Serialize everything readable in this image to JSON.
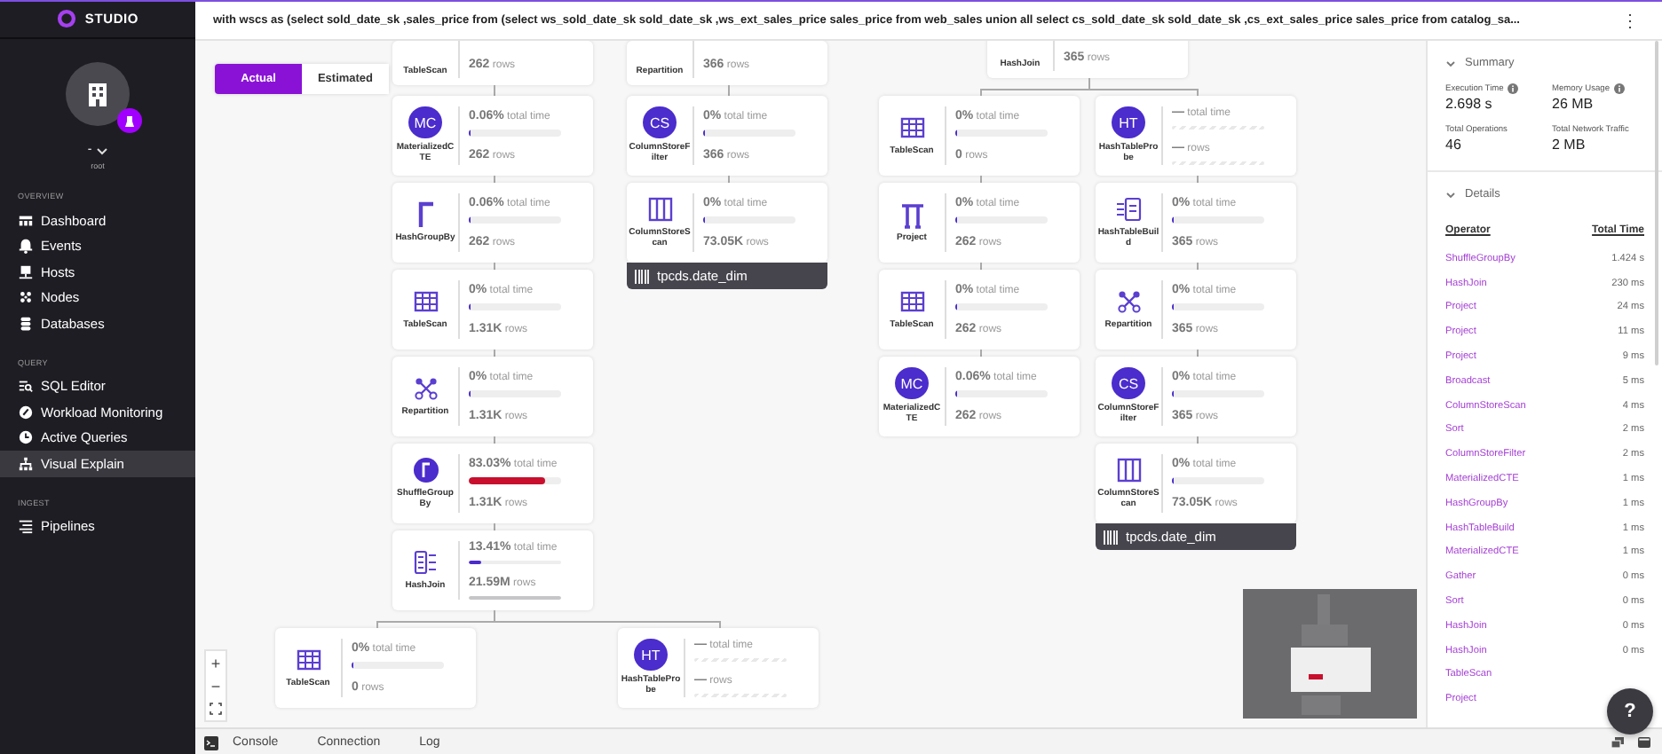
{
  "sidebar": {
    "brand": "STUDIO",
    "account": {
      "name": "-",
      "user": "root"
    },
    "sections": [
      {
        "heading": "OVERVIEW",
        "items": [
          {
            "label": "Dashboard",
            "kind": "dashboard",
            "selected": false
          },
          {
            "label": "Events",
            "kind": "events",
            "selected": false
          },
          {
            "label": "Hosts",
            "kind": "hosts",
            "selected": false
          },
          {
            "label": "Nodes",
            "kind": "nodes",
            "selected": false
          },
          {
            "label": "Databases",
            "kind": "databases",
            "selected": false
          }
        ]
      },
      {
        "heading": "QUERY",
        "items": [
          {
            "label": "SQL Editor",
            "kind": "sql_editor",
            "selected": false
          },
          {
            "label": "Workload Monitoring",
            "kind": "workload",
            "selected": false
          },
          {
            "label": "Active Queries",
            "kind": "active_queries",
            "selected": false
          },
          {
            "label": "Visual Explain",
            "kind": "visual_explain",
            "selected": true
          }
        ]
      },
      {
        "heading": "INGEST",
        "items": [
          {
            "label": "Pipelines",
            "kind": "pipelines",
            "selected": false
          }
        ]
      }
    ]
  },
  "topbar": {
    "query": "with wscs as (select sold_date_sk ,sales_price from (select ws_sold_date_sk sold_date_sk ,ws_ext_sales_price sales_price from web_sales union all select cs_sold_date_sk sold_date_sk ,cs_ext_sales_price sales_price from catalog_sa...",
    "menu": "⋮"
  },
  "view_toggle": [
    {
      "label": "Actual",
      "selected": true
    },
    {
      "label": "Estimated",
      "selected": false
    }
  ],
  "plan": [
    {
      "nodes": [
        {
          "label": "TableScan",
          "rows": "262",
          "rows_unit": "rows"
        },
        {
          "kind": "badge",
          "badge": "MC",
          "label": "MaterializedCTE",
          "time": "0.06%",
          "time_unit": "total time",
          "measured": true,
          "level": 0.0006,
          "rows": "262",
          "rows_unit": "rows"
        },
        {
          "kind": "bracket",
          "label": "HashGroupBy",
          "time": "0.06%",
          "time_unit": "total time",
          "measured": true,
          "level": 0.0006,
          "rows": "262",
          "rows_unit": "rows"
        },
        {
          "kind": "grid",
          "label": "TableScan",
          "time": "0%",
          "time_unit": "total time",
          "measured": true,
          "level": 0,
          "rows": "1.31K",
          "rows_unit": "rows"
        },
        {
          "kind": "network",
          "label": "Repartition",
          "time": "0%",
          "time_unit": "total time",
          "measured": true,
          "level": 0,
          "rows": "1.31K",
          "rows_unit": "rows"
        },
        {
          "kind": "gamma",
          "label": "ShuffleGroupBy",
          "time": "83.03%",
          "time_unit": "total time",
          "measured": true,
          "level": 0.8303,
          "rows": "1.31K",
          "rows_unit": "rows"
        },
        {
          "kind": "list",
          "label": "HashJoin",
          "time": "13.41%",
          "time_unit": "total time",
          "measured": true,
          "level": 0.1341,
          "rows": "21.59M",
          "rows_unit": "rows",
          "rows_bar": {
            "level": 1
          }
        }
      ],
      "branches": [
        {
          "nodes": [
            {
              "kind": "grid",
              "label": "TableScan",
              "time": "0%",
              "time_unit": "total time",
              "measured": true,
              "level": 0,
              "rows": "0",
              "rows_unit": "rows"
            }
          ]
        },
        {
          "nodes": [
            {
              "kind": "badge",
              "badge": "HT",
              "label": "HashTableProbe",
              "time": "—",
              "time_unit": "total time",
              "measured": false,
              "rows": "—",
              "rows_unit": "rows"
            }
          ]
        }
      ]
    },
    {
      "nodes": [
        {
          "label": "Repartition",
          "rows": "366",
          "rows_unit": "rows"
        },
        {
          "kind": "badge",
          "badge": "CS",
          "label": "ColumnStoreFilter",
          "time": "0%",
          "time_unit": "total time",
          "measured": true,
          "level": 0,
          "rows": "366",
          "rows_unit": "rows"
        },
        {
          "kind": "columns",
          "label": "ColumnStoreScan",
          "time": "0%",
          "time_unit": "total time",
          "measured": true,
          "level": 0,
          "rows": "73.05K",
          "rows_unit": "rows"
        }
      ],
      "table": "tpcds.date_dim"
    },
    {
      "nodes": [
        {
          "label": "HashJoin",
          "rows": "365",
          "rows_unit": "rows"
        }
      ],
      "branches": [
        {
          "nodes": [
            {
              "kind": "grid",
              "label": "TableScan",
              "time": "0%",
              "time_unit": "total time",
              "measured": true,
              "level": 0,
              "rows": "0",
              "rows_unit": "rows"
            },
            {
              "kind": "pi",
              "label": "Project",
              "time": "0%",
              "time_unit": "total time",
              "measured": true,
              "level": 0,
              "rows": "262",
              "rows_unit": "rows"
            },
            {
              "kind": "grid",
              "label": "TableScan",
              "time": "0%",
              "time_unit": "total time",
              "measured": true,
              "level": 0,
              "rows": "262",
              "rows_unit": "rows"
            },
            {
              "kind": "badge",
              "badge": "MC",
              "label": "MaterializedCTE",
              "time": "0.06%",
              "time_unit": "total time",
              "measured": true,
              "level": 0.0006,
              "rows": "262",
              "rows_unit": "rows"
            }
          ]
        },
        {
          "nodes": [
            {
              "kind": "badge",
              "badge": "HT",
              "label": "HashTableProbe",
              "time": "—",
              "time_unit": "total time",
              "measured": false,
              "rows": "—",
              "rows_unit": "rows"
            },
            {
              "kind": "build",
              "label": "HashTableBuild",
              "time": "0%",
              "time_unit": "total time",
              "measured": true,
              "level": 0,
              "rows": "365",
              "rows_unit": "rows"
            },
            {
              "kind": "network",
              "label": "Repartition",
              "time": "0%",
              "time_unit": "total time",
              "measured": true,
              "level": 0,
              "rows": "365",
              "rows_unit": "rows"
            },
            {
              "kind": "badge",
              "badge": "CS",
              "label": "ColumnStoreFilter",
              "time": "0%",
              "time_unit": "total time",
              "measured": true,
              "level": 0,
              "rows": "365",
              "rows_unit": "rows"
            },
            {
              "kind": "columns",
              "label": "ColumnStoreScan",
              "time": "0%",
              "time_unit": "total time",
              "measured": true,
              "level": 0,
              "rows": "73.05K",
              "rows_unit": "rows"
            }
          ],
          "table": "tpcds.date_dim"
        }
      ]
    }
  ],
  "zoom_controls": [
    "+",
    "−"
  ],
  "summary": {
    "title": "Summary",
    "expanded": true,
    "stats": [
      {
        "label": "Execution Time",
        "value": "2.698 s",
        "info": true
      },
      {
        "label": "Memory Usage",
        "value": "26 MB",
        "info": true
      },
      {
        "label": "Total Operations",
        "value": "46",
        "info": false
      },
      {
        "label": "Total Network Traffic",
        "value": "2 MB",
        "info": false
      }
    ]
  },
  "details": {
    "title": "Details",
    "expanded": true,
    "columns": [
      "Operator",
      "Total Time"
    ],
    "rows": [
      {
        "operator": "ShuffleGroupBy",
        "time": "1.424 s"
      },
      {
        "operator": "HashJoin",
        "time": "230 ms"
      },
      {
        "operator": "Project",
        "time": "24 ms"
      },
      {
        "operator": "Project",
        "time": "11 ms"
      },
      {
        "operator": "Project",
        "time": "9 ms"
      },
      {
        "operator": "Broadcast",
        "time": "5 ms"
      },
      {
        "operator": "ColumnStoreScan",
        "time": "4 ms"
      },
      {
        "operator": "Sort",
        "time": "2 ms"
      },
      {
        "operator": "ColumnStoreFilter",
        "time": "2 ms"
      },
      {
        "operator": "MaterializedCTE",
        "time": "1 ms"
      },
      {
        "operator": "HashGroupBy",
        "time": "1 ms"
      },
      {
        "operator": "HashTableBuild",
        "time": "1 ms"
      },
      {
        "operator": "MaterializedCTE",
        "time": "1 ms"
      },
      {
        "operator": "Gather",
        "time": "0 ms"
      },
      {
        "operator": "Sort",
        "time": "0 ms"
      },
      {
        "operator": "HashJoin",
        "time": "0 ms"
      },
      {
        "operator": "HashJoin",
        "time": "0 ms"
      },
      {
        "operator": "TableScan"
      },
      {
        "operator": "Project"
      }
    ]
  },
  "bottom_tabs": [
    "Console",
    "Connection",
    "Log"
  ],
  "help": "?"
}
